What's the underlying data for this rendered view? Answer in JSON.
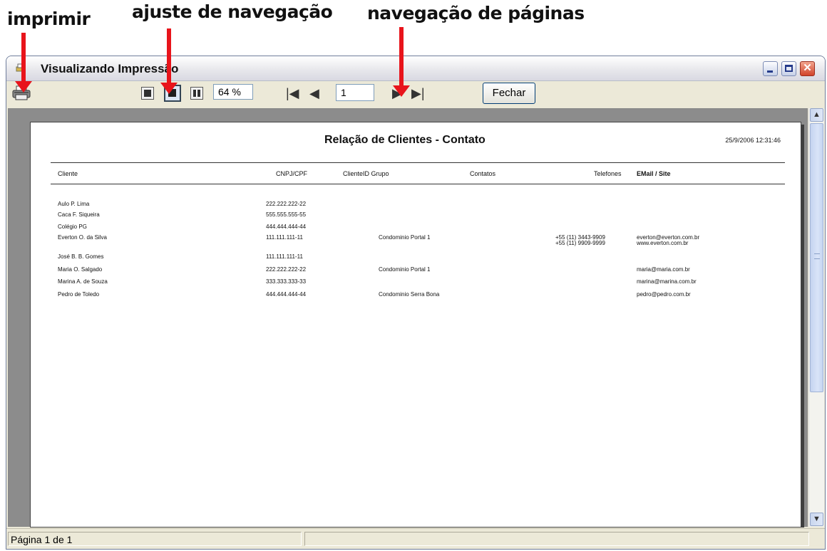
{
  "annotations": {
    "print": "imprimir",
    "nav_adjust": "ajuste de navegação",
    "page_nav": "navegação de páginas"
  },
  "window": {
    "title": "Visualizando Impressão",
    "zoom": "64 %",
    "page_number": "1",
    "close_button": "Fechar",
    "minimize_symbol": "_",
    "close_symbol": "✕"
  },
  "nav": {
    "first": "|◀",
    "prev": "◀",
    "next": "▶",
    "last": "▶|"
  },
  "scroll": {
    "up": "▲",
    "down": "▼"
  },
  "status": {
    "text": "Página 1 de 1"
  },
  "report": {
    "title": "Relação de Clientes - Contato",
    "date": "25/9/2006 12:31:46",
    "headers": {
      "cliente": "Cliente",
      "cnpj": "CNPJ/CPF",
      "cliente_id_grupo": "ClienteID Grupo",
      "contatos": "Contatos",
      "telefones": "Telefones",
      "email": "EMail / Site"
    },
    "rows": [
      {
        "cliente": "Aulo P. Lima",
        "cnpj": "222.222.222-22",
        "grupo": "",
        "tel1": "",
        "tel2": "",
        "email1": "",
        "email2": ""
      },
      {
        "cliente": "Caca F. Siqueira",
        "cnpj": "555.555.555-55",
        "grupo": "",
        "tel1": "",
        "tel2": "",
        "email1": "",
        "email2": ""
      },
      {
        "cliente": "Colégio PG",
        "cnpj": "444.444.444-44",
        "grupo": "",
        "tel1": "",
        "tel2": "",
        "email1": "",
        "email2": ""
      },
      {
        "cliente": "Everton O. da Silva",
        "cnpj": "111.111.111-11",
        "grupo": "Condominio Portal 1",
        "tel1": "+55 (11) 3443-9909",
        "tel2": "+55 (11) 9909-9999",
        "email1": "everton@everton.com.br",
        "email2": "www.everton.com.br"
      },
      {
        "cliente": "José B. B. Gomes",
        "cnpj": "111.111.111-11",
        "grupo": "",
        "tel1": "",
        "tel2": "",
        "email1": "",
        "email2": ""
      },
      {
        "cliente": "Maria O. Salgado",
        "cnpj": "222.222.222-22",
        "grupo": "Condominio Portal 1",
        "tel1": "",
        "tel2": "",
        "email1": "maria@maria.com.br",
        "email2": ""
      },
      {
        "cliente": "Marina A. de Souza",
        "cnpj": "333.333.333-33",
        "grupo": "",
        "tel1": "",
        "tel2": "",
        "email1": "marina@marina.com.br",
        "email2": ""
      },
      {
        "cliente": "Pedro de Toledo",
        "cnpj": "444.444.444-44",
        "grupo": "Condominio Serra Bona",
        "tel1": "",
        "tel2": "",
        "email1": "pedro@pedro.com.br",
        "email2": ""
      }
    ]
  },
  "colors": {
    "arrow": "#e8141b",
    "close_button": "#d1432a",
    "viewport": "#8c8c8c"
  }
}
